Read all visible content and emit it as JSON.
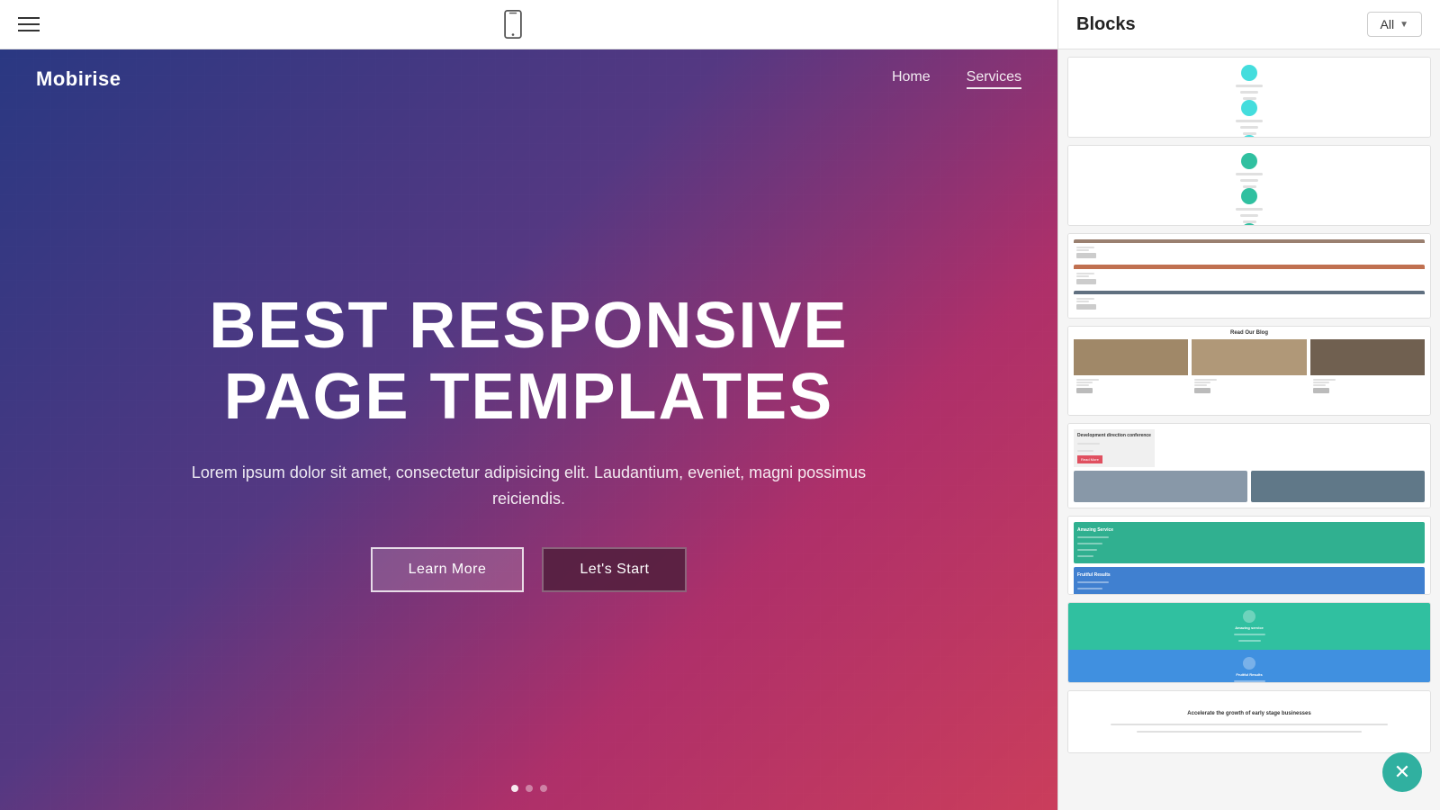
{
  "topbar": {
    "hamburger_label": "Menu",
    "phone_label": "Mobile preview"
  },
  "hero": {
    "logo": "Mobirise",
    "nav_links": [
      {
        "label": "Home",
        "active": false
      },
      {
        "label": "Services",
        "active": true
      }
    ],
    "title_line1": "BEST RESPONSIVE",
    "title_line2": "PAGE TEMPLATES",
    "subtitle": "Lorem ipsum dolor sit amet, consectetur adipisicing elit. Laudantium, eveniet, magni possimus reiciendis.",
    "btn_learn_more": "Learn More",
    "btn_lets_start": "Let's Start"
  },
  "panel": {
    "title": "Blocks",
    "all_button": "All",
    "close_button_label": "Close"
  }
}
